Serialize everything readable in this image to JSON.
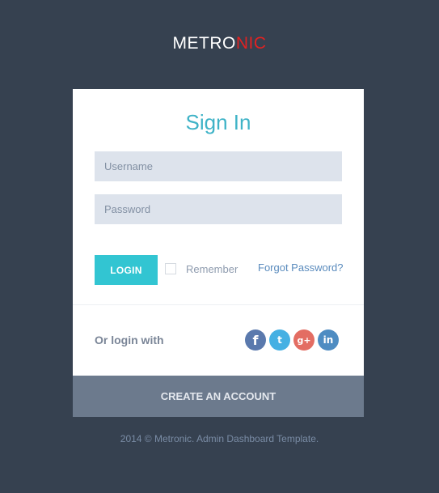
{
  "logo": {
    "part1": "METRO",
    "part2": "NIC",
    "colors": {
      "part1": "#ffffff",
      "part2": "#e02222"
    }
  },
  "form": {
    "title": "Sign In",
    "username_placeholder": "Username",
    "username_value": "",
    "password_placeholder": "Password",
    "password_value": "",
    "login_label": "LOGIN",
    "remember_label": "Remember",
    "remember_checked": false,
    "forgot_label": "Forgot Password?"
  },
  "social": {
    "label": "Or login with",
    "icons": [
      {
        "name": "facebook-icon",
        "glyph": "f",
        "color": "#5a79ad"
      },
      {
        "name": "twitter-icon",
        "glyph": "t",
        "color": "#45b0e3"
      },
      {
        "name": "google-plus-icon",
        "glyph": "g+",
        "color": "#e36d63"
      },
      {
        "name": "linkedin-icon",
        "glyph": "in",
        "color": "#4e8cc2"
      }
    ]
  },
  "create_account_label": "CREATE AN ACCOUNT",
  "footer": "2014 © Metronic. Admin Dashboard Template.",
  "colors": {
    "background": "#364150",
    "accent": "#32c5d2",
    "title": "#3fb3c7",
    "link": "#5a8bbd",
    "create_bar": "#6c7a8d"
  }
}
